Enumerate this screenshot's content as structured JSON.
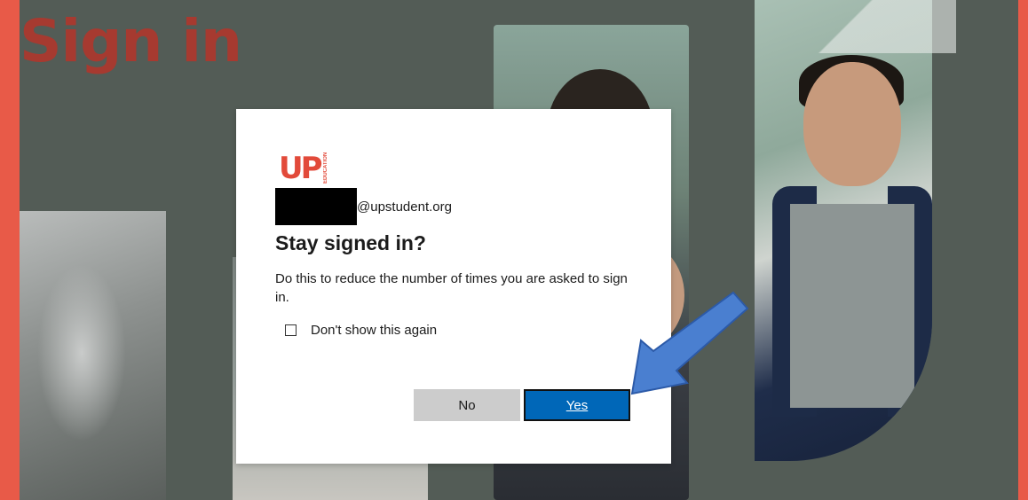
{
  "background": {
    "headline": "Sign in"
  },
  "dialog": {
    "logo": {
      "text": "UP",
      "tagline": "EDUCATION"
    },
    "account": {
      "email_suffix": "@upstudent.org"
    },
    "title": "Stay signed in?",
    "description": "Do this to reduce the number of times you are asked to sign in.",
    "checkbox": {
      "label": "Don't show this again",
      "checked": false
    },
    "buttons": {
      "no_label": "No",
      "yes_label": "Yes"
    }
  },
  "colors": {
    "frame": "#e85a48",
    "backdrop": "#535c56",
    "brand": "#e24a3a",
    "primary_button": "#0067b8",
    "secondary_button": "#cccccc",
    "annotation_arrow": "#4a7fd0"
  },
  "icons": [
    "annotation-arrow-icon",
    "checkbox-icon"
  ]
}
